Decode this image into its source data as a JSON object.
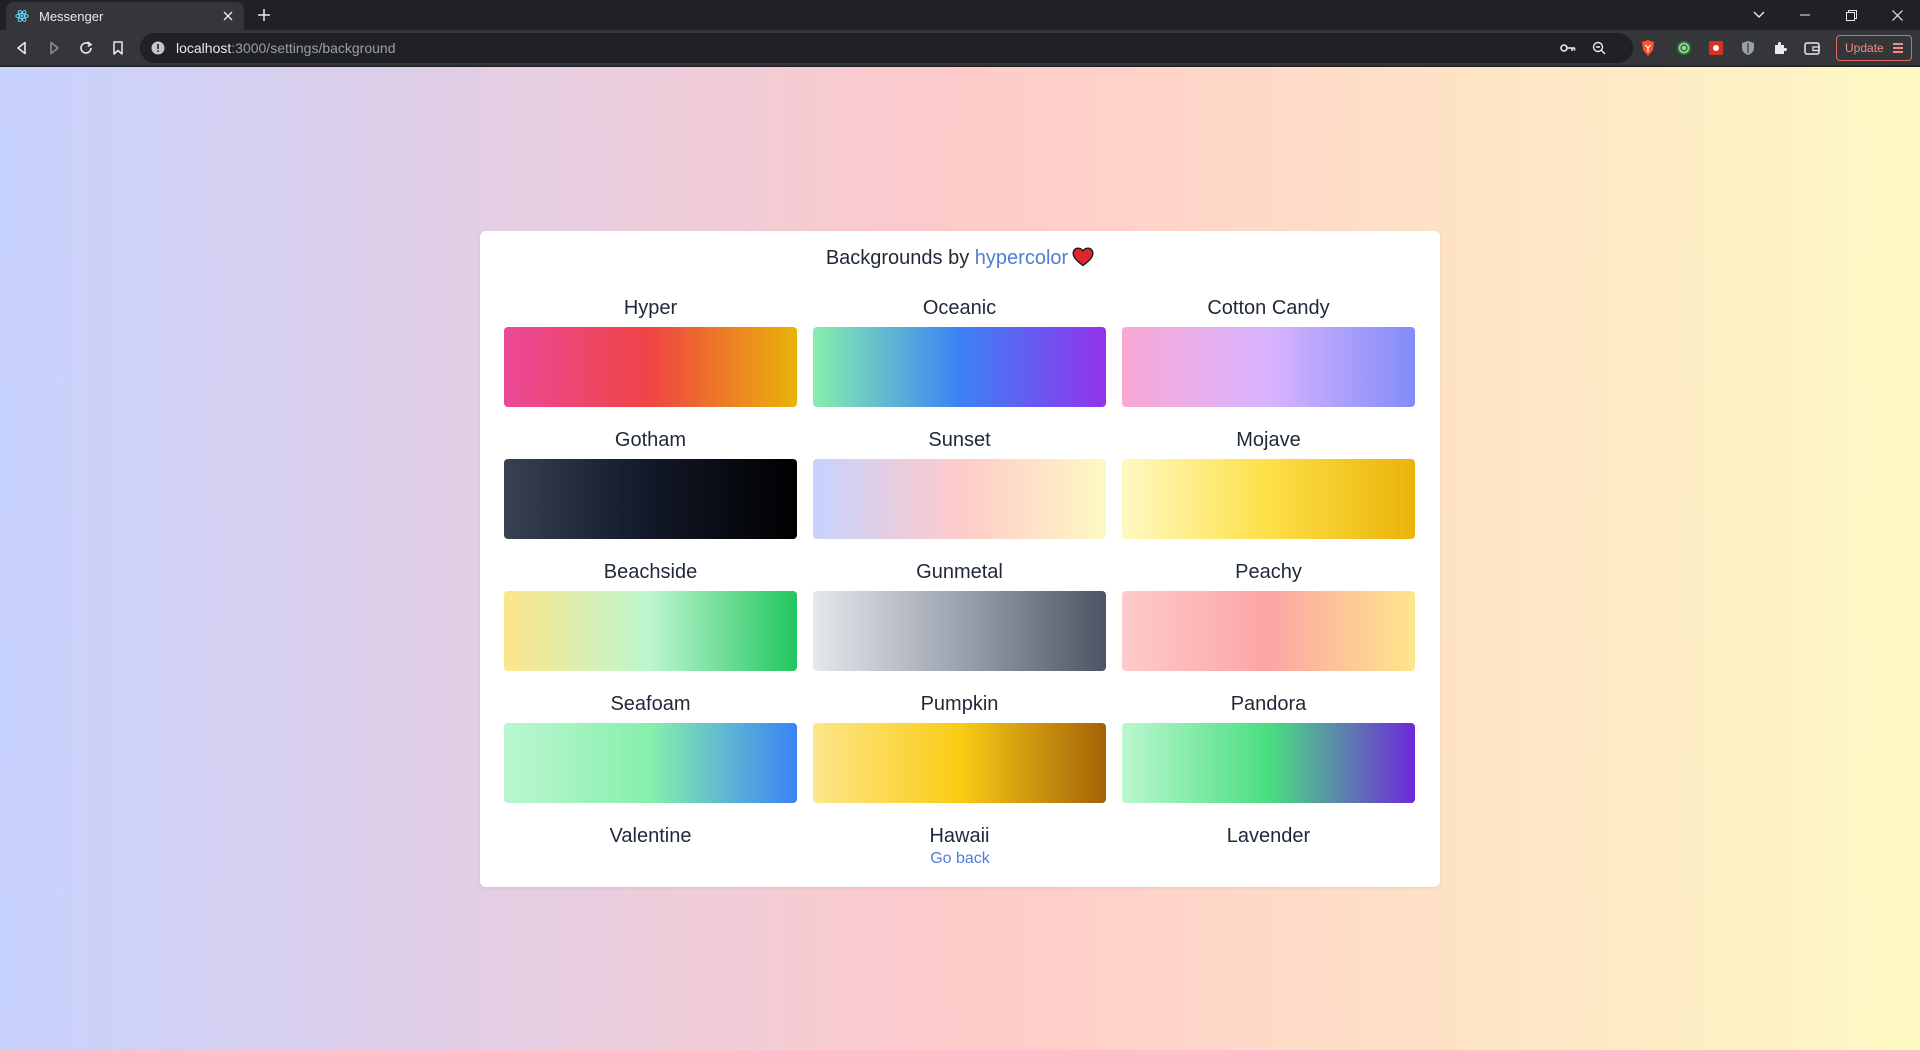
{
  "browser": {
    "tab_title": "Messenger",
    "url_host": "localhost",
    "url_path": ":3000/settings/background",
    "update_label": "Update"
  },
  "page": {
    "title_prefix": "Backgrounds by ",
    "title_link": "hypercolor",
    "go_back": "Go back"
  },
  "backgrounds": [
    {
      "name": "Hyper",
      "colors": [
        "#ec4899",
        "#ef4444",
        "#eab308"
      ]
    },
    {
      "name": "Oceanic",
      "colors": [
        "#86efac",
        "#3b82f6",
        "#9333ea"
      ]
    },
    {
      "name": "Cotton Candy",
      "colors": [
        "#f9a8d4",
        "#d8b4fe",
        "#818cf8"
      ]
    },
    {
      "name": "Gotham",
      "colors": [
        "#374151",
        "#111827",
        "#000000"
      ]
    },
    {
      "name": "Sunset",
      "colors": [
        "#c7d2fe",
        "#fecaca",
        "#fef9c3"
      ]
    },
    {
      "name": "Mojave",
      "colors": [
        "#fef9c3",
        "#fde047",
        "#eab308"
      ]
    },
    {
      "name": "Beachside",
      "colors": [
        "#fde68a",
        "#bbf7d0",
        "#22c55e"
      ]
    },
    {
      "name": "Gunmetal",
      "colors": [
        "#e5e7eb",
        "#9ca3af",
        "#4b5563"
      ]
    },
    {
      "name": "Peachy",
      "colors": [
        "#fecaca",
        "#fca5a5",
        "#fde68a"
      ]
    },
    {
      "name": "Seafoam",
      "colors": [
        "#bbf7d0",
        "#86efac",
        "#3b82f6"
      ]
    },
    {
      "name": "Pumpkin",
      "colors": [
        "#fde68a",
        "#facc15",
        "#a16207"
      ]
    },
    {
      "name": "Pandora",
      "colors": [
        "#bbf7d0",
        "#4ade80",
        "#6d28d9"
      ]
    },
    {
      "name": "Valentine",
      "colors": [
        "#fecdd3",
        "#fb7185",
        "#e11d48"
      ]
    },
    {
      "name": "Hawaii",
      "colors": [
        "#86efac",
        "#fde047",
        "#f9a8d4"
      ]
    },
    {
      "name": "Lavender",
      "colors": [
        "#a5b4fc",
        "#c4b5fd",
        "#f0abfc"
      ]
    }
  ]
}
